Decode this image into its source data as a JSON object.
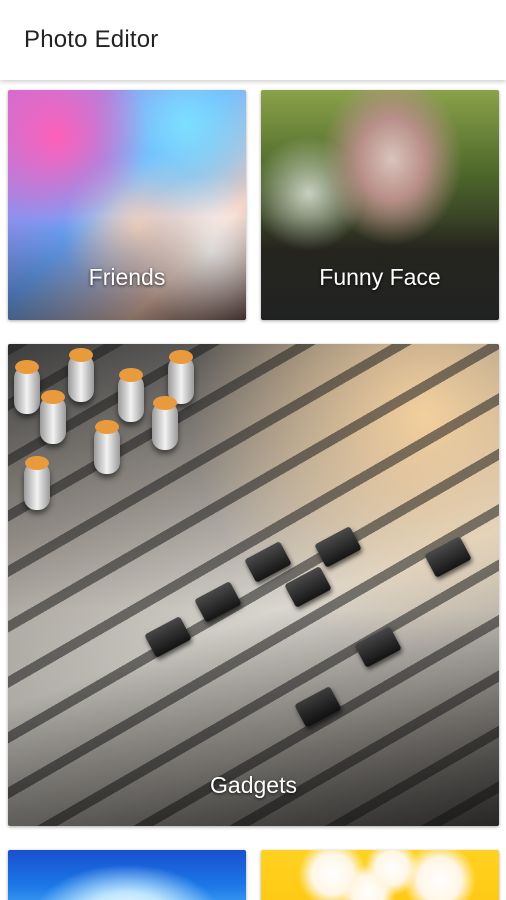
{
  "app_bar": {
    "title": "Photo Editor"
  },
  "categories": [
    {
      "label": "Friends"
    },
    {
      "label": "Funny Face"
    },
    {
      "label": "Gadgets"
    },
    {
      "label": ""
    },
    {
      "label": ""
    }
  ],
  "colors": {
    "app_bar_background": "#ffffff",
    "title_text": "#222222",
    "label_text": "#ffffff"
  }
}
